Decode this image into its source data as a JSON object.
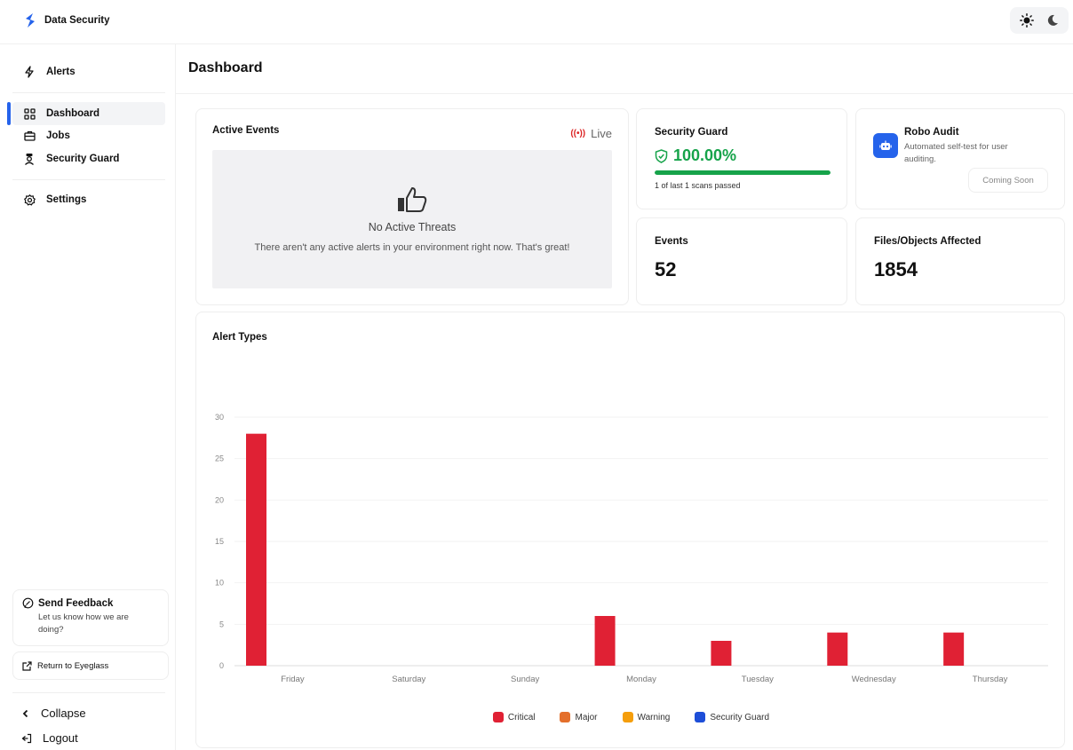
{
  "app": {
    "title": "Data Security"
  },
  "sidebar": {
    "alerts": "Alerts",
    "items": [
      {
        "label": "Dashboard",
        "icon": "grid-icon",
        "active": true
      },
      {
        "label": "Jobs",
        "icon": "briefcase-icon"
      },
      {
        "label": "Security Guard",
        "icon": "guard-icon"
      }
    ],
    "settings": "Settings",
    "feedback": {
      "title": "Send Feedback",
      "subtitle": "Let us know how we are doing?"
    },
    "return_link": "Return to Eyeglass",
    "collapse": "Collapse",
    "logout": "Logout"
  },
  "page": {
    "title": "Dashboard"
  },
  "active_events": {
    "title": "Active Events",
    "live_label": "Live",
    "empty_title": "No Active Threats",
    "empty_subtitle": "There aren't any active alerts in your environment right now. That's great!"
  },
  "security_guard": {
    "title": "Security Guard",
    "value": "100.00%",
    "progress": 1.0,
    "note": "1 of last 1 scans passed",
    "color": "#16a34a"
  },
  "robo_audit": {
    "title": "Robo Audit",
    "subtitle": "Automated self-test for user auditing.",
    "button": "Coming Soon"
  },
  "events": {
    "label": "Events",
    "value": "52"
  },
  "files": {
    "label": "Files/Objects Affected",
    "value": "1854"
  },
  "chart_data": {
    "type": "bar",
    "title": "Alert Types",
    "categories": [
      "Friday",
      "Saturday",
      "Sunday",
      "Monday",
      "Tuesday",
      "Wednesday",
      "Thursday"
    ],
    "series": [
      {
        "name": "Critical",
        "color": "#e02134",
        "values": [
          28,
          0,
          0,
          6,
          3,
          4,
          4
        ]
      },
      {
        "name": "Major",
        "color": "#e46f2b",
        "values": [
          0,
          0,
          0,
          0,
          0,
          0,
          0
        ]
      },
      {
        "name": "Warning",
        "color": "#f59e0b",
        "values": [
          0,
          0,
          0,
          0,
          0,
          0,
          0
        ]
      },
      {
        "name": "Security Guard",
        "color": "#1d4ed8",
        "values": [
          0,
          0,
          0,
          0,
          0,
          0,
          0
        ]
      }
    ],
    "yticks": [
      0,
      5,
      10,
      15,
      20,
      25,
      30
    ],
    "ylim": [
      0,
      30
    ],
    "grid": true,
    "legend": "bottom"
  }
}
